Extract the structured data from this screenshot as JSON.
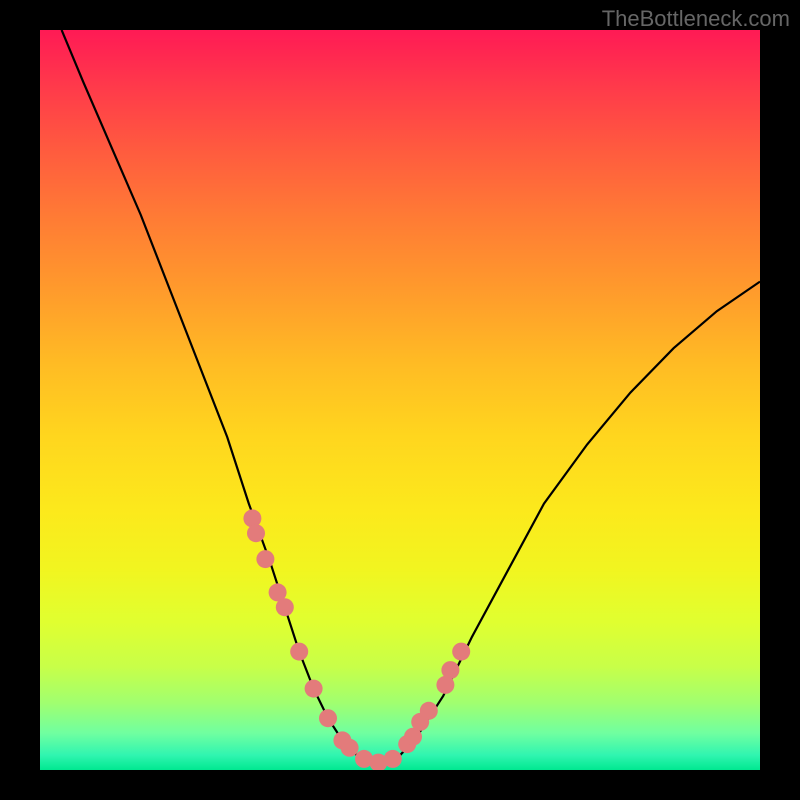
{
  "watermark": "TheBottleneck.com",
  "chart_data": {
    "type": "line",
    "title": "",
    "xlabel": "",
    "ylabel": "",
    "xlim": [
      0,
      100
    ],
    "ylim": [
      0,
      100
    ],
    "curve": {
      "x": [
        3,
        6,
        10,
        14,
        18,
        22,
        26,
        29,
        32,
        34,
        36,
        38,
        40,
        42,
        44,
        46,
        48,
        50,
        52,
        56,
        60,
        65,
        70,
        76,
        82,
        88,
        94,
        100
      ],
      "y": [
        100,
        93,
        84,
        75,
        65,
        55,
        45,
        36,
        28,
        22,
        16,
        11,
        7,
        4,
        2,
        1,
        1,
        2,
        4,
        10,
        18,
        27,
        36,
        44,
        51,
        57,
        62,
        66
      ]
    },
    "markers": {
      "x": [
        29.5,
        30.0,
        31.3,
        33.0,
        34.0,
        36.0,
        38.0,
        40.0,
        42.0,
        43.0,
        45.0,
        47.0,
        49.0,
        51.0,
        51.8,
        52.8,
        54.0,
        56.3,
        57.0,
        58.5
      ],
      "y": [
        34.0,
        32.0,
        28.5,
        24.0,
        22.0,
        16.0,
        11.0,
        7.0,
        4.0,
        3.0,
        1.5,
        1.0,
        1.5,
        3.5,
        4.5,
        6.5,
        8.0,
        11.5,
        13.5,
        16.0
      ]
    },
    "marker_color": "#e37b7b",
    "curve_color": "#000000",
    "gradient": {
      "top": "#ff1a55",
      "bottom": "#00e890"
    }
  }
}
